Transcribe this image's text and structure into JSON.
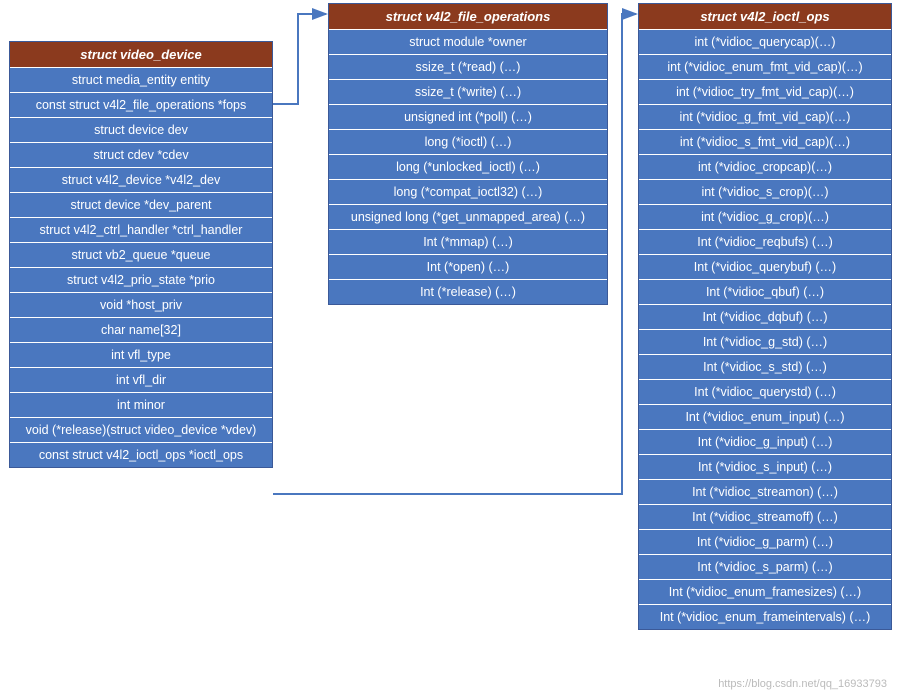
{
  "structs": {
    "video_device": {
      "title": "struct video_device",
      "rows": [
        "struct media_entity entity",
        "const struct v4l2_file_operations *fops",
        "struct device dev",
        "struct cdev *cdev",
        "struct v4l2_device *v4l2_dev",
        "struct device *dev_parent",
        "struct v4l2_ctrl_handler *ctrl_handler",
        "struct vb2_queue *queue",
        "struct v4l2_prio_state *prio",
        "void *host_priv",
        "char name[32]",
        "int vfl_type",
        "int vfl_dir",
        "int minor",
        "void (*release)(struct video_device *vdev)",
        "const struct v4l2_ioctl_ops *ioctl_ops"
      ]
    },
    "file_ops": {
      "title": "struct v4l2_file_operations",
      "rows": [
        "struct module *owner",
        "ssize_t  (*read) (…)",
        "ssize_t  (*write) (…)",
        "unsigned int  (*poll) (…)",
        "long  (*ioctl) (…)",
        "long  (*unlocked_ioctl) (…)",
        "long  (*compat_ioctl32) (…)",
        "unsigned long  (*get_unmapped_area) (…)",
        "Int  (*mmap) (…)",
        "Int  (*open) (…)",
        "Int  (*release) (…)"
      ]
    },
    "ioctl_ops": {
      "title": "struct v4l2_ioctl_ops",
      "rows": [
        "int (*vidioc_querycap)(…)",
        "int (*vidioc_enum_fmt_vid_cap)(…)",
        "int (*vidioc_try_fmt_vid_cap)(…)",
        "int (*vidioc_g_fmt_vid_cap)(…)",
        "int (*vidioc_s_fmt_vid_cap)(…)",
        "int (*vidioc_cropcap)(…)",
        "int (*vidioc_s_crop)(…)",
        "int (*vidioc_g_crop)(…)",
        "Int  (*vidioc_reqbufs) (…)",
        "Int  (*vidioc_querybuf) (…)",
        "Int  (*vidioc_qbuf) (…)",
        "Int  (*vidioc_dqbuf) (…)",
        "Int  (*vidioc_g_std) (…)",
        "Int  (*vidioc_s_std) (…)",
        "Int  (*vidioc_querystd) (…)",
        "Int  (*vidioc_enum_input) (…)",
        "Int  (*vidioc_g_input) (…)",
        "Int  (*vidioc_s_input) (…)",
        "Int  (*vidioc_streamon) (…)",
        "Int  (*vidioc_streamoff) (…)",
        "Int  (*vidioc_g_parm) (…)",
        "Int  (*vidioc_s_parm) (…)",
        "Int  (*vidioc_enum_framesizes) (…)",
        "Int  (*vidioc_enum_frameintervals) (…)"
      ]
    }
  },
  "watermark": "https://blog.csdn.net/qq_16933793"
}
